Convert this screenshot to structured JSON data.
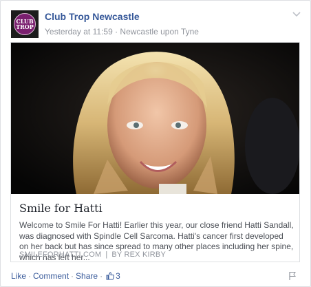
{
  "post": {
    "page_name": "Club Trop Newcastle",
    "avatar_text_1": "CLUB",
    "avatar_text_2": "TROP",
    "timestamp": "Yesterday at 11:59",
    "separator": " · ",
    "location": "Newcastle upon Tyne"
  },
  "link": {
    "title": "Smile for Hatti",
    "description": "Welcome to Smile For Hatti! Earlier this year, our close friend Hatti Sandall, was diagnosed with Spindle Cell Sarcoma. Hatti's cancer first developed on her back but has since spread to many other places including her spine, which has left her...",
    "domain": "SMILEFORHATTI.COM",
    "divider": "|",
    "author": "BY REX KIRBY"
  },
  "actions": {
    "like": "Like",
    "comment": "Comment",
    "share": "Share",
    "dot": "·",
    "like_count": "3"
  },
  "colors": {
    "link_blue": "#365899",
    "meta_gray": "#90949c"
  }
}
